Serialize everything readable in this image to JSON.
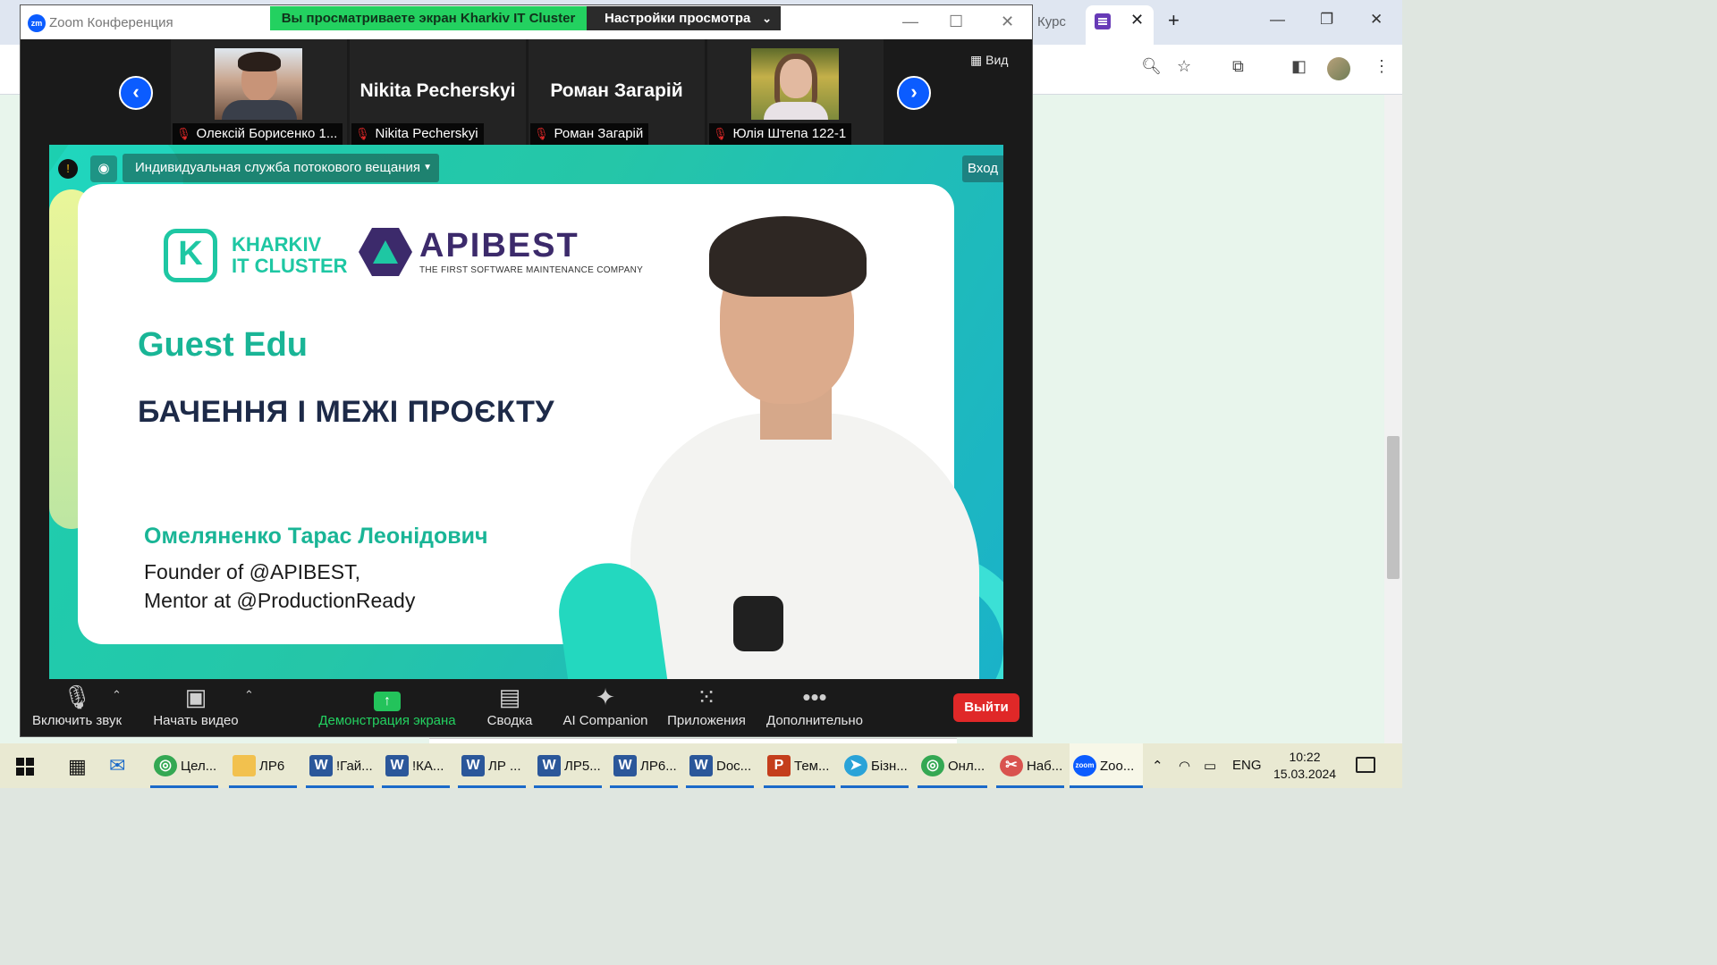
{
  "browser": {
    "tab_partial_text": "Курс",
    "active_tab_partial": "(",
    "new_tab": "+",
    "window_controls": [
      "—",
      "❐",
      "✕"
    ],
    "toolbar_icons": [
      "zoom-icon",
      "star-icon",
      "extensions-icon",
      "sidepanel-icon",
      "profile-avatar",
      "menu-icon"
    ]
  },
  "zoom": {
    "title": "Zoom Конференция",
    "logo_text": "zm",
    "share_banner": "Вы просматриваете экран Kharkiv IT Cluster",
    "view_options": "Настройки просмотра",
    "window_controls": [
      "—",
      "☐",
      "✕"
    ],
    "view_button": "Вид",
    "participants": [
      {
        "label": "Олексій Борисенко 1...",
        "has_video": true
      },
      {
        "label": "Nikita Pecherskyi",
        "big_name": "Nikita Pecherskyi",
        "has_video": false
      },
      {
        "label": "Роман Загарій",
        "big_name": "Роман Загарій",
        "has_video": false
      },
      {
        "label": "Юлія Штепа 122-1",
        "has_video": true
      }
    ],
    "stream_service": "Индивидуальная служба потокового вещания",
    "enter_button": "Вход",
    "slide": {
      "kharkiv_line1": "KHARKIV",
      "kharkiv_line2": "IT CLUSTER",
      "kharkiv_mark": "K",
      "apibest_word": "APIBEST",
      "apibest_sub": "THE FIRST SOFTWARE MAINTENANCE COMPANY",
      "guest": "Guest Edu",
      "topic": "БАЧЕННЯ І МЕЖІ ПРОЄКТУ",
      "speaker": "Омеляненко Тарас Леонідович",
      "role_line1": "Founder of @APIBEST,",
      "role_line2": "Mentor at @ProductionReady"
    },
    "controls": {
      "mute": "Включить звук",
      "video": "Начать видео",
      "share": "Демонстрация экрана",
      "summary": "Сводка",
      "ai": "AI Companion",
      "apps": "Приложения",
      "more": "Дополнительно",
      "leave": "Выйти"
    }
  },
  "taskbar": {
    "apps": [
      {
        "icon": "chrome-icon",
        "text": "Цел..."
      },
      {
        "icon": "folder-icon",
        "text": "ЛР6"
      },
      {
        "icon": "word-icon",
        "text": "!Гай..."
      },
      {
        "icon": "word-icon",
        "text": "!КА..."
      },
      {
        "icon": "word-icon",
        "text": "ЛР ..."
      },
      {
        "icon": "word-icon",
        "text": "ЛР5..."
      },
      {
        "icon": "word-icon",
        "text": "ЛР6..."
      },
      {
        "icon": "word-icon",
        "text": "Doc..."
      },
      {
        "icon": "powerpoint-icon",
        "text": "Тем..."
      },
      {
        "icon": "telegram-icon",
        "text": "Бізн..."
      },
      {
        "icon": "chrome-icon",
        "text": "Онл..."
      },
      {
        "icon": "app-icon",
        "text": "Наб..."
      },
      {
        "icon": "zoom-icon",
        "text": "Zoo..."
      }
    ],
    "language": "ENG",
    "time": "10:22",
    "date": "15.03.2024"
  },
  "colors": {
    "zoom_blue": "#0b5cff",
    "share_green": "#23d160",
    "leave_red": "#e02828",
    "slide_teal": "#19b596",
    "slide_navy": "#1d2a48"
  }
}
